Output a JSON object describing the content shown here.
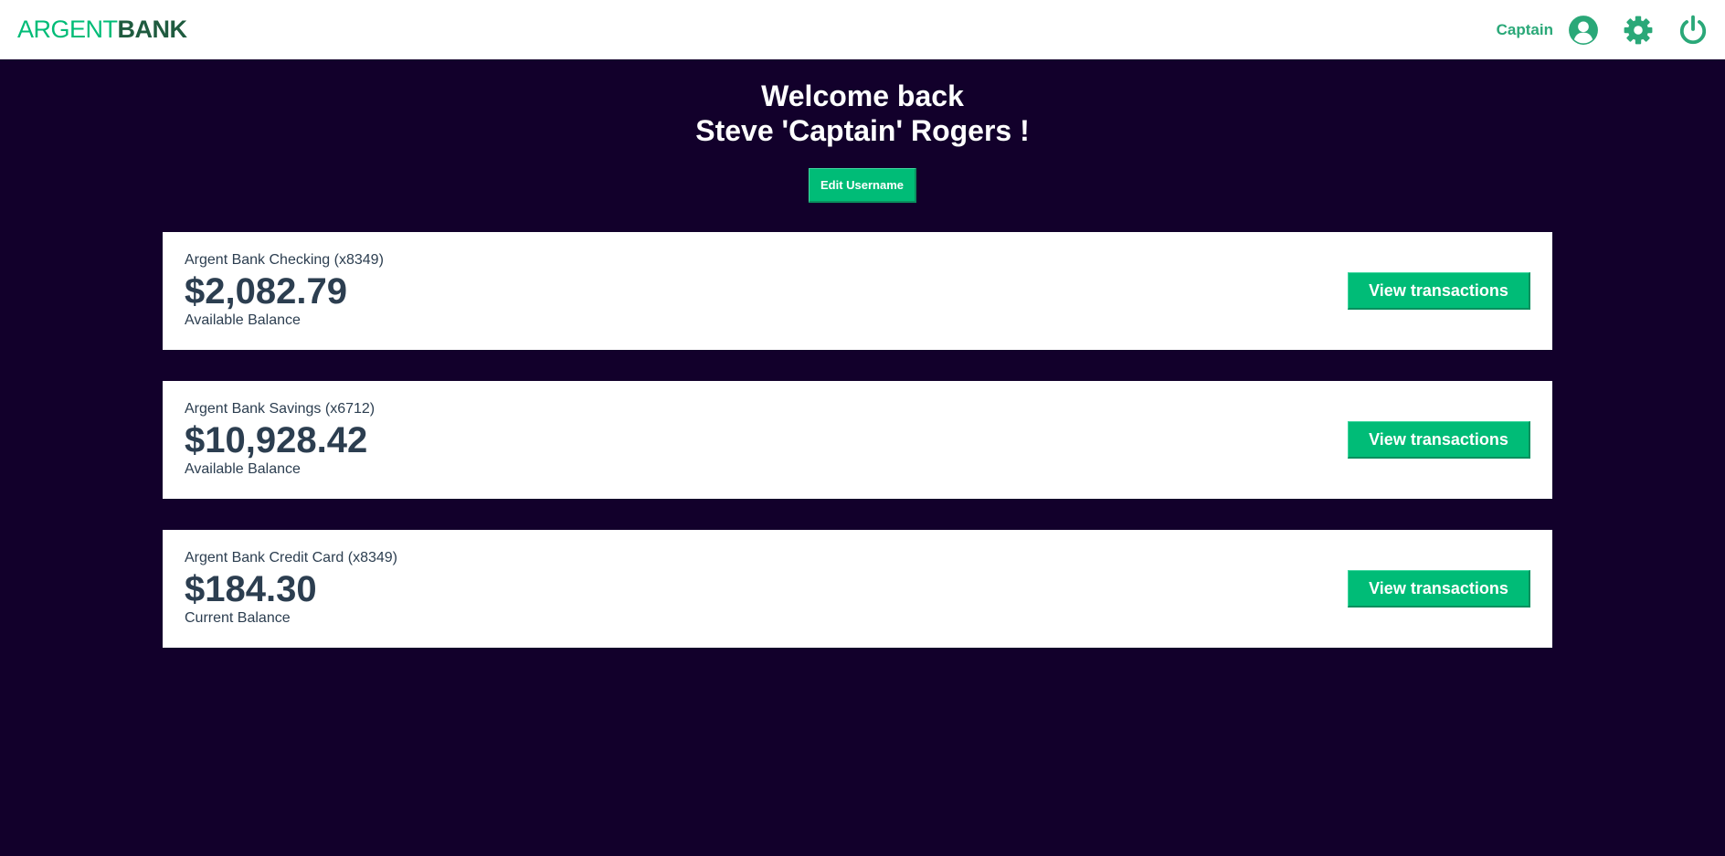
{
  "nav": {
    "logo_part1": "ARGENT",
    "logo_part2": "BANK",
    "username": "Captain",
    "icons": [
      "user-circle-icon",
      "gear-icon",
      "power-icon"
    ]
  },
  "header": {
    "line1": "Welcome back",
    "line2": "Steve 'Captain' Rogers !",
    "edit_label": "Edit Username"
  },
  "accounts": [
    {
      "title": "Argent Bank Checking (x8349)",
      "amount": "$2,082.79",
      "description": "Available Balance",
      "button": "View transactions"
    },
    {
      "title": "Argent Bank Savings (x6712)",
      "amount": "$10,928.42",
      "description": "Available Balance",
      "button": "View transactions"
    },
    {
      "title": "Argent Bank Credit Card (x8349)",
      "amount": "$184.30",
      "description": "Current Balance",
      "button": "View transactions"
    }
  ],
  "colors": {
    "accent": "#00bc77",
    "background": "#12002b",
    "text_dark": "#2c3e50"
  }
}
